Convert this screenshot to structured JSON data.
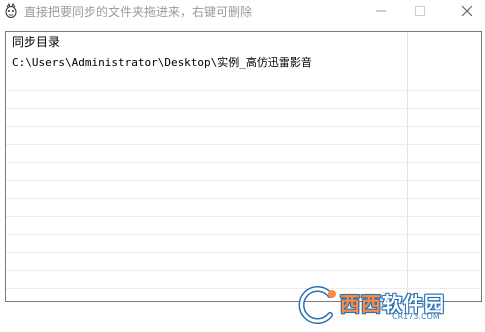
{
  "window": {
    "title": "直接把要同步的文件夹拖进来，右键可删除",
    "minimize_icon": "minimize-icon",
    "maximize_icon": "maximize-icon",
    "close_icon": "close-icon"
  },
  "list": {
    "header": "同步目录",
    "items": [
      {
        "path": "C:\\Users\\Administrator\\Desktop\\实例_高仿迅雷影音"
      }
    ]
  },
  "watermark": {
    "brand_part1": "西西",
    "brand_part2": "软件园",
    "site": "CR173.COM"
  },
  "colors": {
    "title_text": "#9a9a9a",
    "border": "#7a7a7a",
    "watermark_blue": "#2a6fb3",
    "watermark_orange": "#ff8a3d"
  }
}
